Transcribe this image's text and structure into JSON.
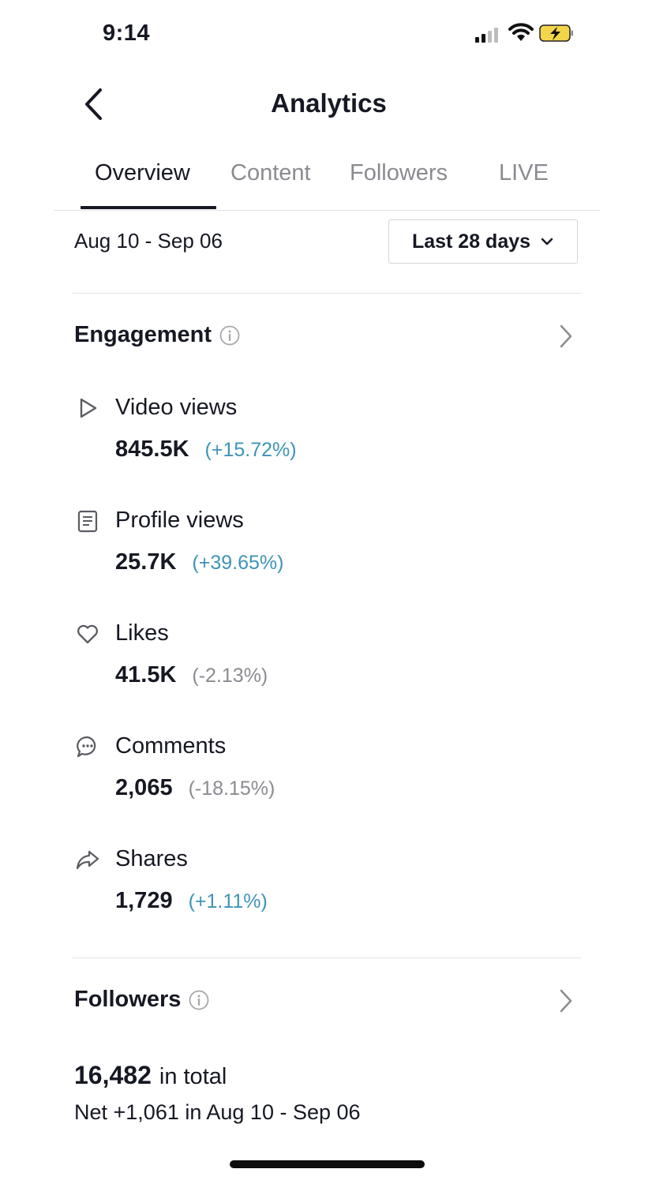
{
  "status_bar": {
    "time": "9:14"
  },
  "header": {
    "title": "Analytics"
  },
  "tabs": [
    {
      "label": "Overview",
      "active": true
    },
    {
      "label": "Content",
      "active": false
    },
    {
      "label": "Followers",
      "active": false
    },
    {
      "label": "LIVE",
      "active": false
    }
  ],
  "date_range": {
    "text": "Aug 10 - Sep 06",
    "selector_label": "Last 28 days"
  },
  "engagement": {
    "title": "Engagement",
    "metrics": [
      {
        "label": "Video views",
        "value": "845.5K",
        "change": "(+15.72%)",
        "icon": "play-icon"
      },
      {
        "label": "Profile views",
        "value": "25.7K",
        "change": "(+39.65%)",
        "icon": "profile-doc-icon"
      },
      {
        "label": "Likes",
        "value": "41.5K",
        "change": "(-2.13%)",
        "icon": "heart-icon"
      },
      {
        "label": "Comments",
        "value": "2,065",
        "change": "(-18.15%)",
        "icon": "comment-bubble-icon"
      },
      {
        "label": "Shares",
        "value": "1,729",
        "change": "(+1.11%)",
        "icon": "share-arrow-icon"
      }
    ]
  },
  "followers": {
    "title": "Followers",
    "total": "16,482",
    "total_suffix": "in total",
    "net": "Net +1,061 in Aug 10 - Sep 06"
  },
  "colors": {
    "positive": "#3f93b7",
    "negative": "#8a8b91",
    "text": "#161823"
  }
}
